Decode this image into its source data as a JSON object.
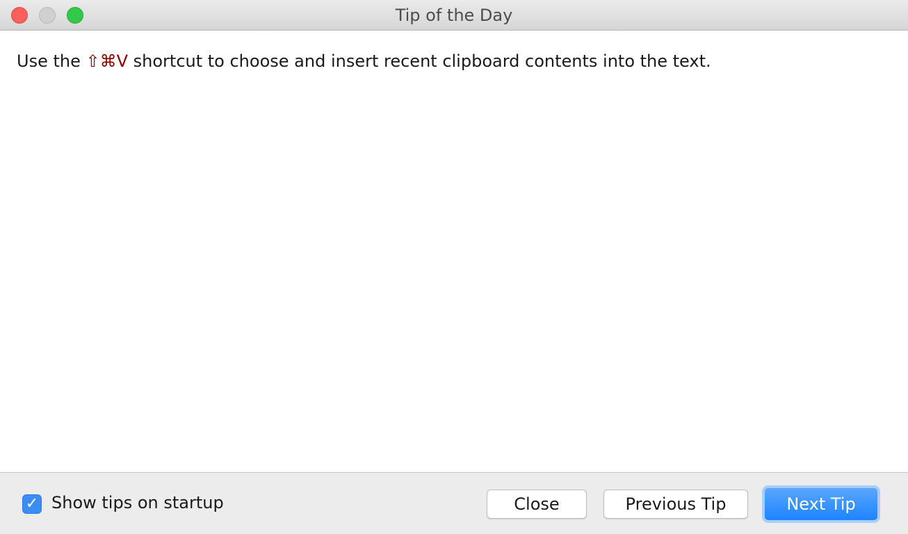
{
  "window": {
    "title": "Tip of the Day"
  },
  "tip": {
    "prefix": "Use the ",
    "shortcut": "⇧⌘V",
    "suffix": " shortcut to choose and insert recent clipboard contents into the text."
  },
  "footer": {
    "show_tips_checked": true,
    "show_tips_label": "Show tips on startup",
    "checkmark": "✓",
    "close_label": "Close",
    "previous_label": "Previous Tip",
    "next_label": "Next Tip"
  },
  "colors": {
    "shortcut": "#8b0000",
    "accent": "#1d84ff",
    "traffic_close": "#fc605c",
    "traffic_max": "#34c84a"
  }
}
